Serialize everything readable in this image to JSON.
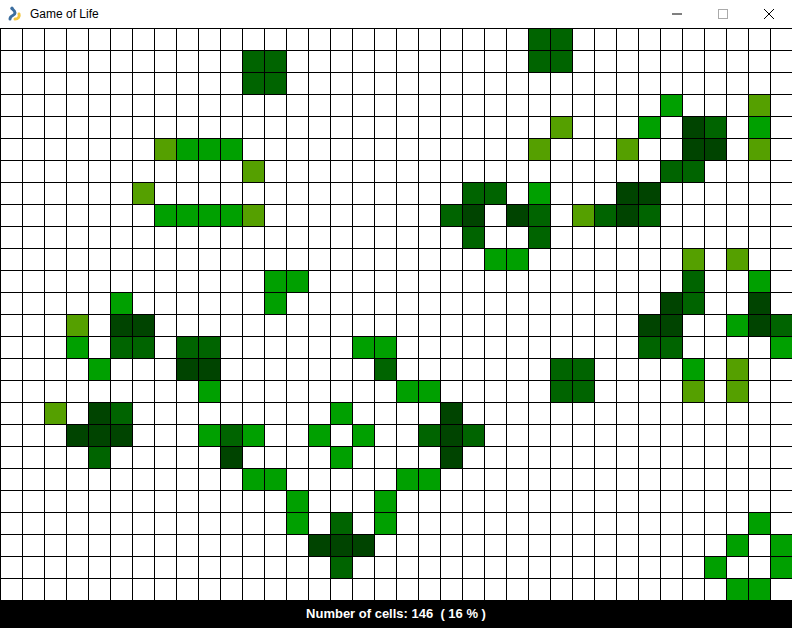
{
  "window": {
    "title": "Game of Life"
  },
  "status_bar": "Number of cells: 146  ( 16 % )",
  "grid": {
    "cells": [
      {
        "row": 0,
        "col": 24,
        "color": "#006400"
      },
      {
        "row": 0,
        "col": 25,
        "color": "#006400"
      },
      {
        "row": 1,
        "col": 11,
        "color": "#006400"
      },
      {
        "row": 1,
        "col": 12,
        "color": "#006400"
      },
      {
        "row": 1,
        "col": 24,
        "color": "#006400"
      },
      {
        "row": 1,
        "col": 25,
        "color": "#006400"
      },
      {
        "row": 2,
        "col": 11,
        "color": "#006400"
      },
      {
        "row": 2,
        "col": 12,
        "color": "#006400"
      },
      {
        "row": 3,
        "col": 30,
        "color": "#00a000"
      },
      {
        "row": 3,
        "col": 34,
        "color": "#55a000"
      },
      {
        "row": 4,
        "col": 25,
        "color": "#55a000"
      },
      {
        "row": 4,
        "col": 29,
        "color": "#00a000"
      },
      {
        "row": 4,
        "col": 31,
        "color": "#004400"
      },
      {
        "row": 4,
        "col": 32,
        "color": "#006400"
      },
      {
        "row": 4,
        "col": 34,
        "color": "#00a000"
      },
      {
        "row": 5,
        "col": 7,
        "color": "#55a000"
      },
      {
        "row": 5,
        "col": 8,
        "color": "#00a000"
      },
      {
        "row": 5,
        "col": 9,
        "color": "#00a000"
      },
      {
        "row": 5,
        "col": 10,
        "color": "#00a000"
      },
      {
        "row": 5,
        "col": 24,
        "color": "#55a000"
      },
      {
        "row": 5,
        "col": 28,
        "color": "#55a000"
      },
      {
        "row": 5,
        "col": 31,
        "color": "#004400"
      },
      {
        "row": 5,
        "col": 32,
        "color": "#004400"
      },
      {
        "row": 5,
        "col": 34,
        "color": "#55a000"
      },
      {
        "row": 6,
        "col": 11,
        "color": "#55a000"
      },
      {
        "row": 6,
        "col": 30,
        "color": "#006400"
      },
      {
        "row": 6,
        "col": 31,
        "color": "#006400"
      },
      {
        "row": 7,
        "col": 6,
        "color": "#55a000"
      },
      {
        "row": 7,
        "col": 21,
        "color": "#006400"
      },
      {
        "row": 7,
        "col": 22,
        "color": "#006400"
      },
      {
        "row": 7,
        "col": 24,
        "color": "#00a000"
      },
      {
        "row": 7,
        "col": 28,
        "color": "#004400"
      },
      {
        "row": 7,
        "col": 29,
        "color": "#004400"
      },
      {
        "row": 8,
        "col": 7,
        "color": "#00a000"
      },
      {
        "row": 8,
        "col": 8,
        "color": "#00a000"
      },
      {
        "row": 8,
        "col": 9,
        "color": "#00a000"
      },
      {
        "row": 8,
        "col": 10,
        "color": "#00a000"
      },
      {
        "row": 8,
        "col": 11,
        "color": "#55a000"
      },
      {
        "row": 8,
        "col": 20,
        "color": "#006400"
      },
      {
        "row": 8,
        "col": 21,
        "color": "#004400"
      },
      {
        "row": 8,
        "col": 23,
        "color": "#004400"
      },
      {
        "row": 8,
        "col": 24,
        "color": "#006400"
      },
      {
        "row": 8,
        "col": 26,
        "color": "#55a000"
      },
      {
        "row": 8,
        "col": 27,
        "color": "#006400"
      },
      {
        "row": 8,
        "col": 28,
        "color": "#004400"
      },
      {
        "row": 8,
        "col": 29,
        "color": "#006400"
      },
      {
        "row": 9,
        "col": 21,
        "color": "#006400"
      },
      {
        "row": 9,
        "col": 24,
        "color": "#006400"
      },
      {
        "row": 10,
        "col": 22,
        "color": "#00a000"
      },
      {
        "row": 10,
        "col": 23,
        "color": "#00a000"
      },
      {
        "row": 10,
        "col": 31,
        "color": "#55a000"
      },
      {
        "row": 10,
        "col": 33,
        "color": "#55a000"
      },
      {
        "row": 11,
        "col": 12,
        "color": "#00a000"
      },
      {
        "row": 11,
        "col": 13,
        "color": "#00a000"
      },
      {
        "row": 11,
        "col": 31,
        "color": "#006400"
      },
      {
        "row": 11,
        "col": 34,
        "color": "#00a000"
      },
      {
        "row": 12,
        "col": 5,
        "color": "#00a000"
      },
      {
        "row": 12,
        "col": 12,
        "color": "#00a000"
      },
      {
        "row": 12,
        "col": 30,
        "color": "#004400"
      },
      {
        "row": 12,
        "col": 31,
        "color": "#006400"
      },
      {
        "row": 12,
        "col": 34,
        "color": "#004400"
      },
      {
        "row": 13,
        "col": 3,
        "color": "#55a000"
      },
      {
        "row": 13,
        "col": 5,
        "color": "#004400"
      },
      {
        "row": 13,
        "col": 6,
        "color": "#004400"
      },
      {
        "row": 13,
        "col": 29,
        "color": "#004400"
      },
      {
        "row": 13,
        "col": 30,
        "color": "#004400"
      },
      {
        "row": 13,
        "col": 33,
        "color": "#00a000"
      },
      {
        "row": 13,
        "col": 34,
        "color": "#004400"
      },
      {
        "row": 13,
        "col": 35,
        "color": "#006400"
      },
      {
        "row": 14,
        "col": 3,
        "color": "#00a000"
      },
      {
        "row": 14,
        "col": 5,
        "color": "#006400"
      },
      {
        "row": 14,
        "col": 6,
        "color": "#006400"
      },
      {
        "row": 14,
        "col": 8,
        "color": "#006400"
      },
      {
        "row": 14,
        "col": 9,
        "color": "#006400"
      },
      {
        "row": 14,
        "col": 16,
        "color": "#00a000"
      },
      {
        "row": 14,
        "col": 17,
        "color": "#00a000"
      },
      {
        "row": 14,
        "col": 29,
        "color": "#006400"
      },
      {
        "row": 14,
        "col": 30,
        "color": "#006400"
      },
      {
        "row": 14,
        "col": 35,
        "color": "#00a000"
      },
      {
        "row": 15,
        "col": 4,
        "color": "#00a000"
      },
      {
        "row": 15,
        "col": 8,
        "color": "#004400"
      },
      {
        "row": 15,
        "col": 9,
        "color": "#004400"
      },
      {
        "row": 15,
        "col": 17,
        "color": "#006400"
      },
      {
        "row": 15,
        "col": 25,
        "color": "#006400"
      },
      {
        "row": 15,
        "col": 26,
        "color": "#006400"
      },
      {
        "row": 15,
        "col": 31,
        "color": "#00a000"
      },
      {
        "row": 15,
        "col": 33,
        "color": "#55a000"
      },
      {
        "row": 16,
        "col": 9,
        "color": "#00a000"
      },
      {
        "row": 16,
        "col": 18,
        "color": "#00a000"
      },
      {
        "row": 16,
        "col": 19,
        "color": "#00a000"
      },
      {
        "row": 16,
        "col": 25,
        "color": "#006400"
      },
      {
        "row": 16,
        "col": 26,
        "color": "#006400"
      },
      {
        "row": 16,
        "col": 31,
        "color": "#55a000"
      },
      {
        "row": 16,
        "col": 33,
        "color": "#55a000"
      },
      {
        "row": 17,
        "col": 2,
        "color": "#55a000"
      },
      {
        "row": 17,
        "col": 4,
        "color": "#004400"
      },
      {
        "row": 17,
        "col": 5,
        "color": "#006400"
      },
      {
        "row": 17,
        "col": 15,
        "color": "#00a000"
      },
      {
        "row": 17,
        "col": 20,
        "color": "#004400"
      },
      {
        "row": 18,
        "col": 3,
        "color": "#004400"
      },
      {
        "row": 18,
        "col": 4,
        "color": "#004400"
      },
      {
        "row": 18,
        "col": 5,
        "color": "#004400"
      },
      {
        "row": 18,
        "col": 9,
        "color": "#00a000"
      },
      {
        "row": 18,
        "col": 10,
        "color": "#006400"
      },
      {
        "row": 18,
        "col": 11,
        "color": "#00a000"
      },
      {
        "row": 18,
        "col": 14,
        "color": "#00a000"
      },
      {
        "row": 18,
        "col": 16,
        "color": "#00a000"
      },
      {
        "row": 18,
        "col": 19,
        "color": "#006400"
      },
      {
        "row": 18,
        "col": 20,
        "color": "#004400"
      },
      {
        "row": 18,
        "col": 21,
        "color": "#006400"
      },
      {
        "row": 19,
        "col": 4,
        "color": "#006400"
      },
      {
        "row": 19,
        "col": 10,
        "color": "#004400"
      },
      {
        "row": 19,
        "col": 15,
        "color": "#00a000"
      },
      {
        "row": 19,
        "col": 20,
        "color": "#004400"
      },
      {
        "row": 20,
        "col": 11,
        "color": "#00a000"
      },
      {
        "row": 20,
        "col": 12,
        "color": "#00a000"
      },
      {
        "row": 20,
        "col": 18,
        "color": "#00a000"
      },
      {
        "row": 20,
        "col": 19,
        "color": "#00a000"
      },
      {
        "row": 21,
        "col": 13,
        "color": "#00a000"
      },
      {
        "row": 21,
        "col": 17,
        "color": "#00a000"
      },
      {
        "row": 22,
        "col": 13,
        "color": "#00a000"
      },
      {
        "row": 22,
        "col": 15,
        "color": "#006400"
      },
      {
        "row": 22,
        "col": 17,
        "color": "#00a000"
      },
      {
        "row": 22,
        "col": 34,
        "color": "#00a000"
      },
      {
        "row": 23,
        "col": 14,
        "color": "#004400"
      },
      {
        "row": 23,
        "col": 15,
        "color": "#004400"
      },
      {
        "row": 23,
        "col": 16,
        "color": "#004400"
      },
      {
        "row": 23,
        "col": 33,
        "color": "#00a000"
      },
      {
        "row": 23,
        "col": 35,
        "color": "#00a000"
      },
      {
        "row": 24,
        "col": 15,
        "color": "#006400"
      },
      {
        "row": 24,
        "col": 32,
        "color": "#00a000"
      },
      {
        "row": 24,
        "col": 35,
        "color": "#00a000"
      },
      {
        "row": 25,
        "col": 33,
        "color": "#00a000"
      },
      {
        "row": 25,
        "col": 34,
        "color": "#00a000"
      }
    ]
  }
}
